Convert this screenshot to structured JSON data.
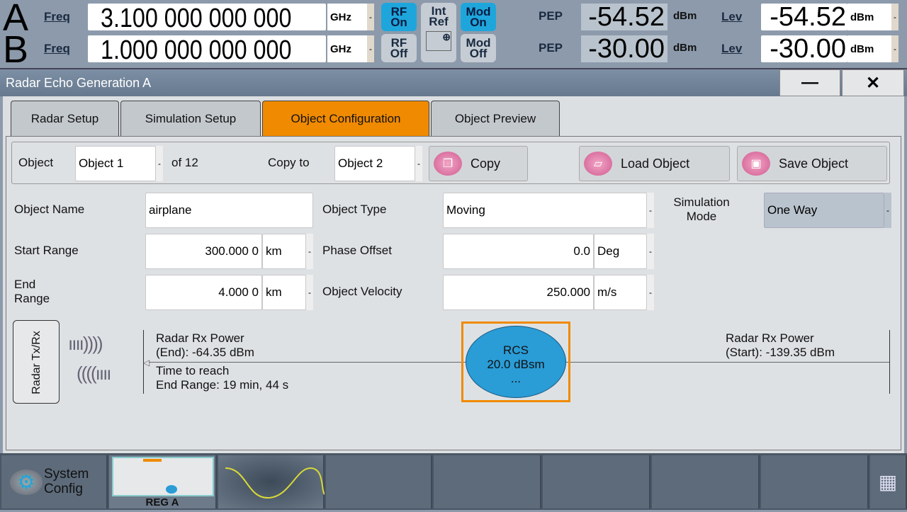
{
  "header": {
    "a": {
      "label": "A",
      "freq_label": "Freq",
      "freq": "3.100 000 000 000",
      "unit": "GHz",
      "rf": "RF On",
      "mod": "Mod On",
      "pep_label": "PEP",
      "pep": "-54.52",
      "pep_unit": "dBm",
      "lev_label": "Lev",
      "lev": "-54.52",
      "lev_unit": "dBm"
    },
    "b": {
      "label": "B",
      "freq_label": "Freq",
      "freq": "1.000 000 000 000",
      "unit": "GHz",
      "rf": "RF Off",
      "mod": "Mod Off",
      "pep_label": "PEP",
      "pep": "-30.00",
      "pep_unit": "dBm",
      "lev_label": "Lev",
      "lev": "-30.00",
      "lev_unit": "dBm"
    },
    "ref": "Int Ref",
    "colors": {
      "on": "#1ea6dc",
      "off": "#c5ccd4"
    }
  },
  "window": {
    "title": "Radar Echo Generation A",
    "minimize": "—",
    "close": "✕"
  },
  "tabs": [
    {
      "label": "Radar Setup"
    },
    {
      "label": "Simulation Setup"
    },
    {
      "label": "Object Configuration",
      "active": true
    },
    {
      "label": "Object Preview"
    }
  ],
  "toolbar": {
    "object_label": "Object",
    "object": "Object 1",
    "of": "of 12",
    "copy_to_label": "Copy to",
    "copy_to": "Object 2",
    "copy": "Copy",
    "load": "Load Object",
    "save": "Save Object"
  },
  "form": {
    "name_label": "Object Name",
    "name": "airplane",
    "type_label": "Object Type",
    "type": "Moving",
    "sim_mode_label": "Simulation Mode",
    "sim_mode": "One Way",
    "start_label": "Start Range",
    "start": "300.000 0",
    "start_unit": "km",
    "phase_label": "Phase Offset",
    "phase": "0.0",
    "phase_unit": "Deg",
    "end_label": "End Range",
    "end": "4.000 0",
    "end_unit": "km",
    "vel_label": "Object Velocity",
    "vel": "250.000",
    "vel_unit": "m/s"
  },
  "diagram": {
    "radar": "Radar Tx/Rx",
    "rx_end_1": "Radar Rx Power",
    "rx_end_2": "(End): -64.35 dBm",
    "time_1": "Time to reach",
    "time_2": "End Range: 19 min, 44 s",
    "rcs_1": "RCS",
    "rcs_2": "20.0 dBsm",
    "rcs_3": "...",
    "rx_start_1": "Radar Rx Power",
    "rx_start_2": "(Start): -139.35 dBm"
  },
  "taskbar": {
    "system_1": "System",
    "system_2": "Config",
    "rega": "REG A"
  }
}
